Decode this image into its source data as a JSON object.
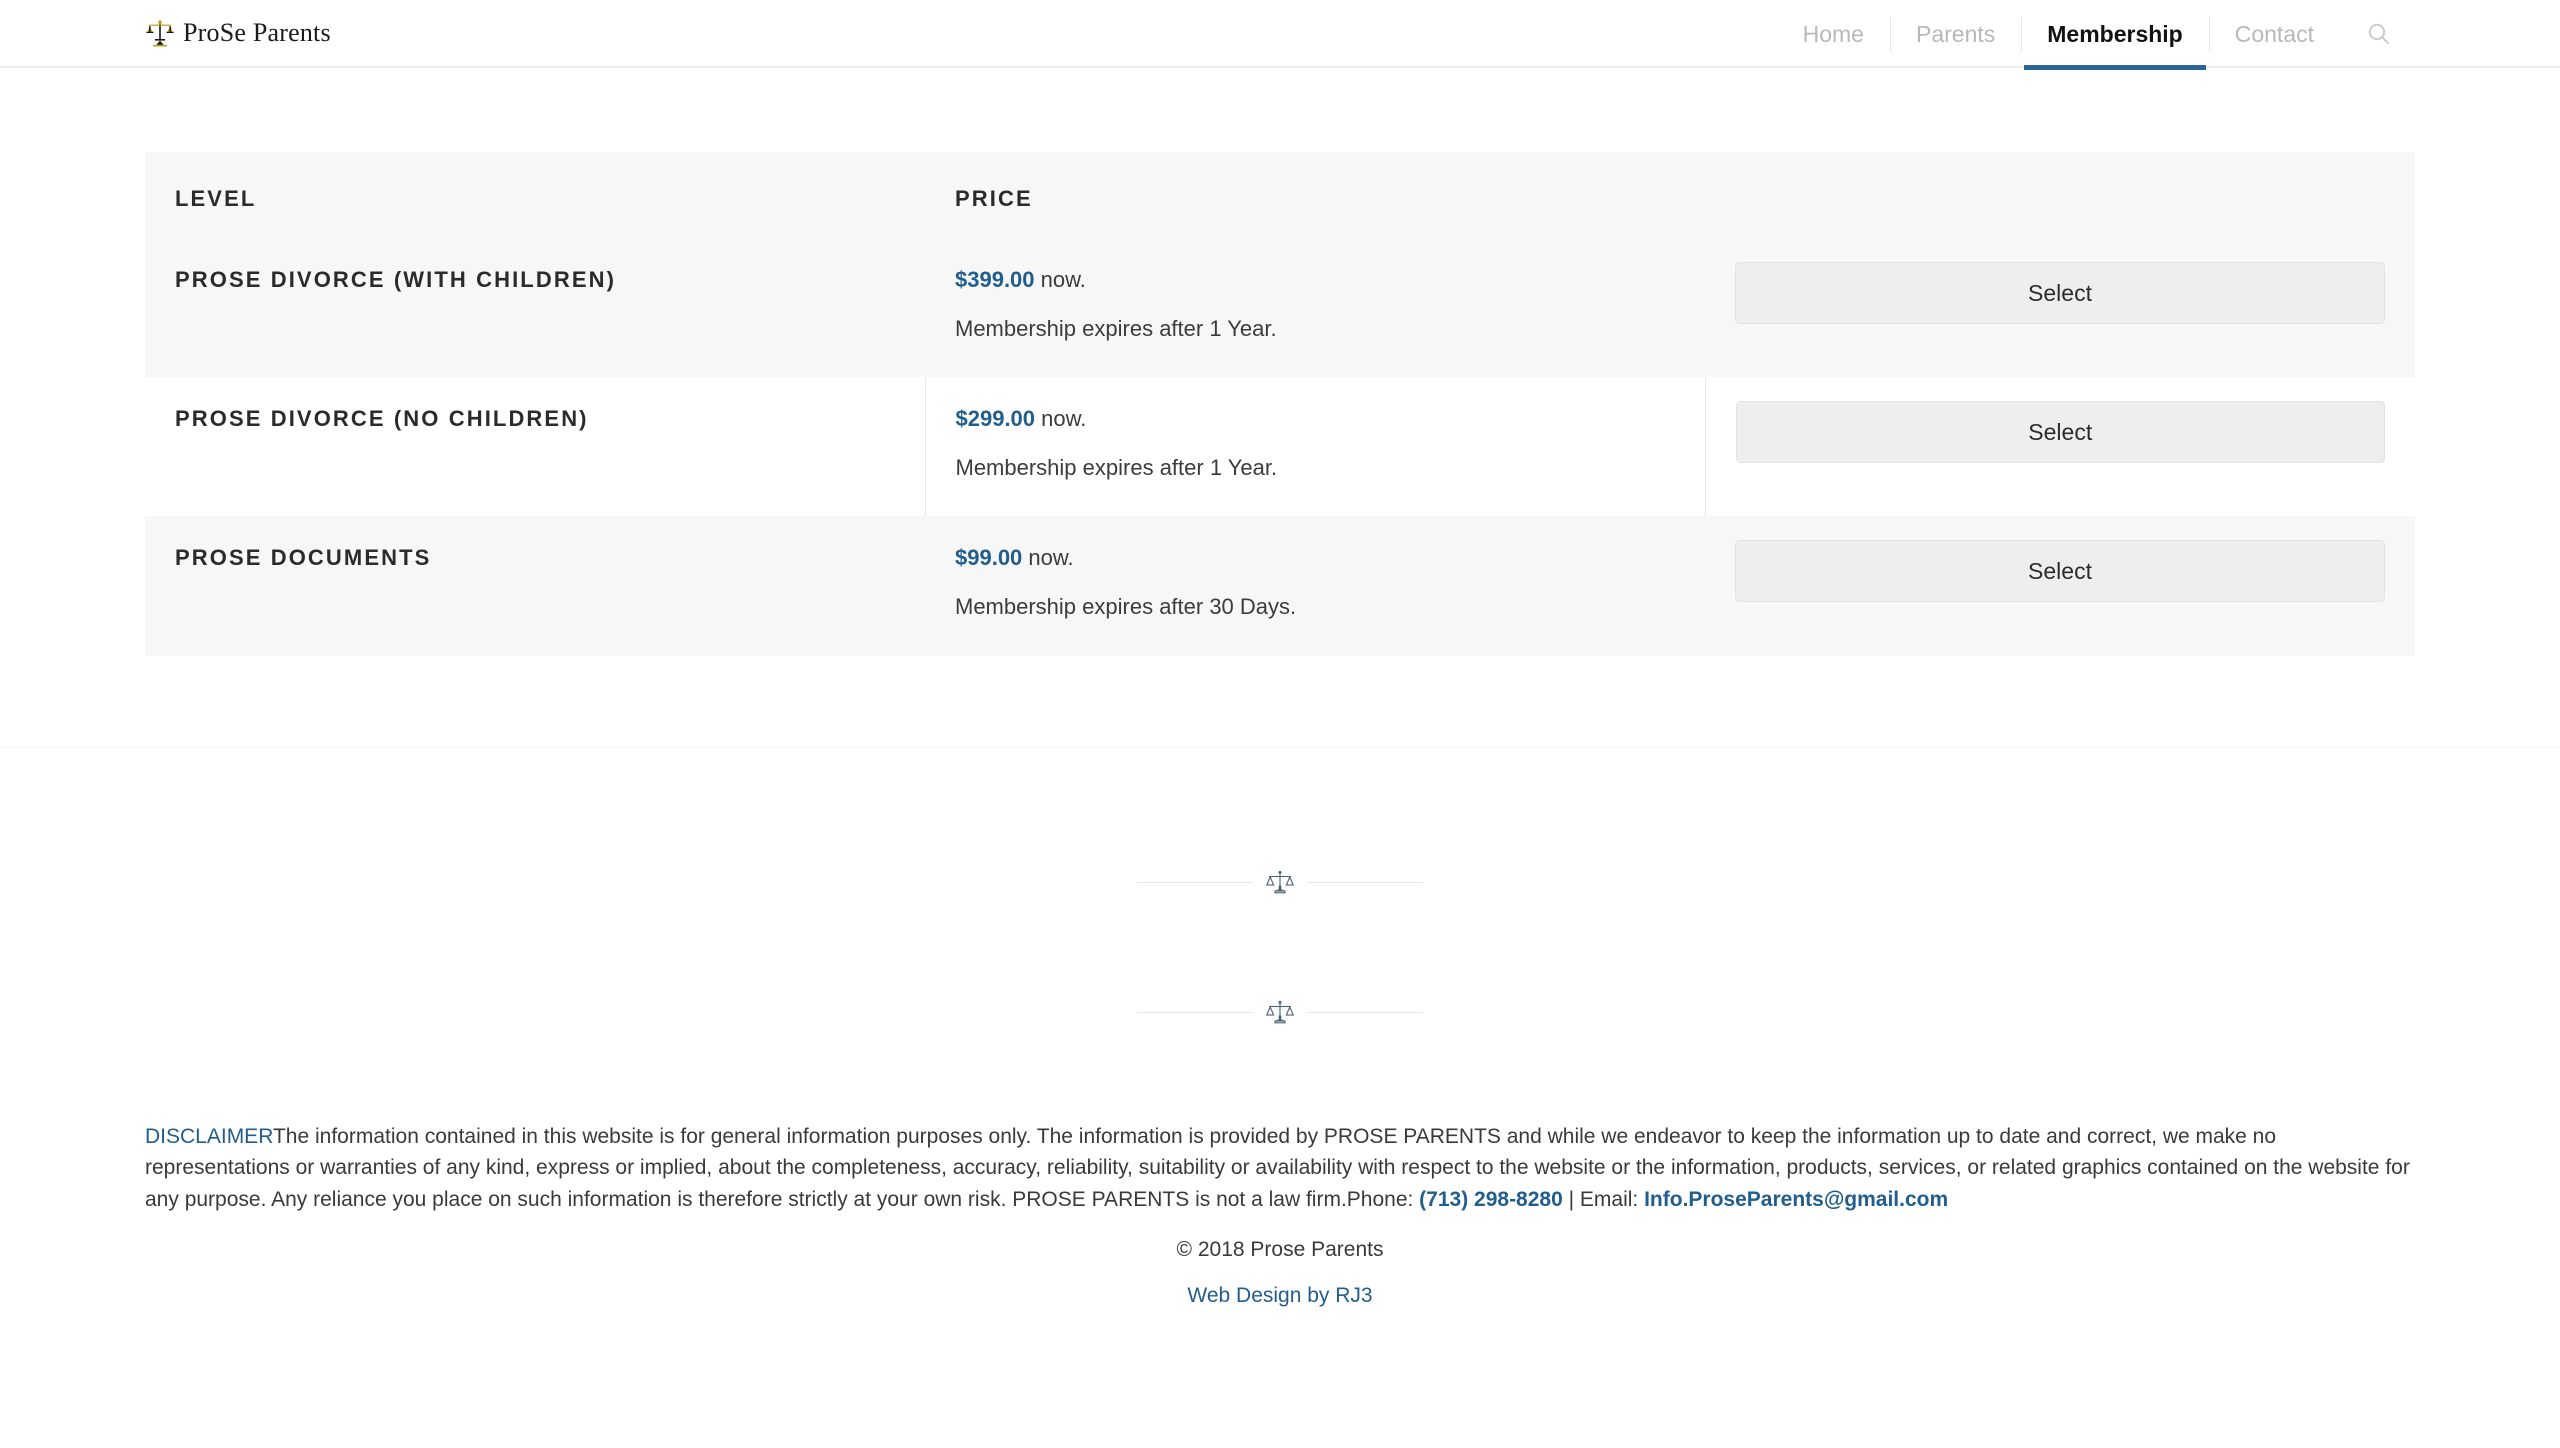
{
  "header": {
    "brand_name": "ProSe Parents",
    "brand_icon": "scales-of-justice-logo",
    "nav": [
      {
        "label": "Home",
        "active": false
      },
      {
        "label": "Parents",
        "active": false
      },
      {
        "label": "Membership",
        "active": true
      },
      {
        "label": "Contact",
        "active": false
      }
    ],
    "search_icon": "search-icon",
    "accent_color": "#2a6496"
  },
  "pricing": {
    "columns": {
      "level": "LEVEL",
      "price": "PRICE",
      "action": ""
    },
    "rows": [
      {
        "level": "PROSE DIVORCE (WITH CHILDREN)",
        "price_amount": "$399.00",
        "price_suffix": " now.",
        "expiry": "Membership expires after 1 Year.",
        "button_label": "Select",
        "shaded": true
      },
      {
        "level": "PROSE DIVORCE (NO CHILDREN)",
        "price_amount": "$299.00",
        "price_suffix": " now.",
        "expiry": "Membership expires after 1 Year.",
        "button_label": "Select",
        "shaded": false
      },
      {
        "level": "PROSE DOCUMENTS",
        "price_amount": "$99.00",
        "price_suffix": " now.",
        "expiry": "Membership expires after 30 Days.",
        "button_label": "Select",
        "shaded": true
      }
    ],
    "price_link_color": "#215e8e"
  },
  "footer": {
    "separator_icon": "scales-of-justice-icon",
    "separator_count": 2,
    "disclaimer": {
      "label": "DISCLAIMER",
      "body_part_1": "The information contained in this website is for general information purposes only. The information is provided by PROSE PARENTS and while we endeavor to keep the information up to date and correct, we make no representations or warranties of any kind, express or implied, about the completeness, accuracy, reliability, suitability or availability with respect to the website or the information, products, services, or related graphics contained on the website for any purpose. Any reliance you place on such information is therefore strictly at your own risk. PROSE PARENTS is not a law firm.Phone: ",
      "phone": "(713) 298-8280",
      "separator": " | Email: ",
      "email": "Info.ProseParents@gmail.com"
    },
    "copyright": "© 2018 Prose Parents",
    "credit": "Web Design by RJ3",
    "link_color": "#215e8e"
  }
}
